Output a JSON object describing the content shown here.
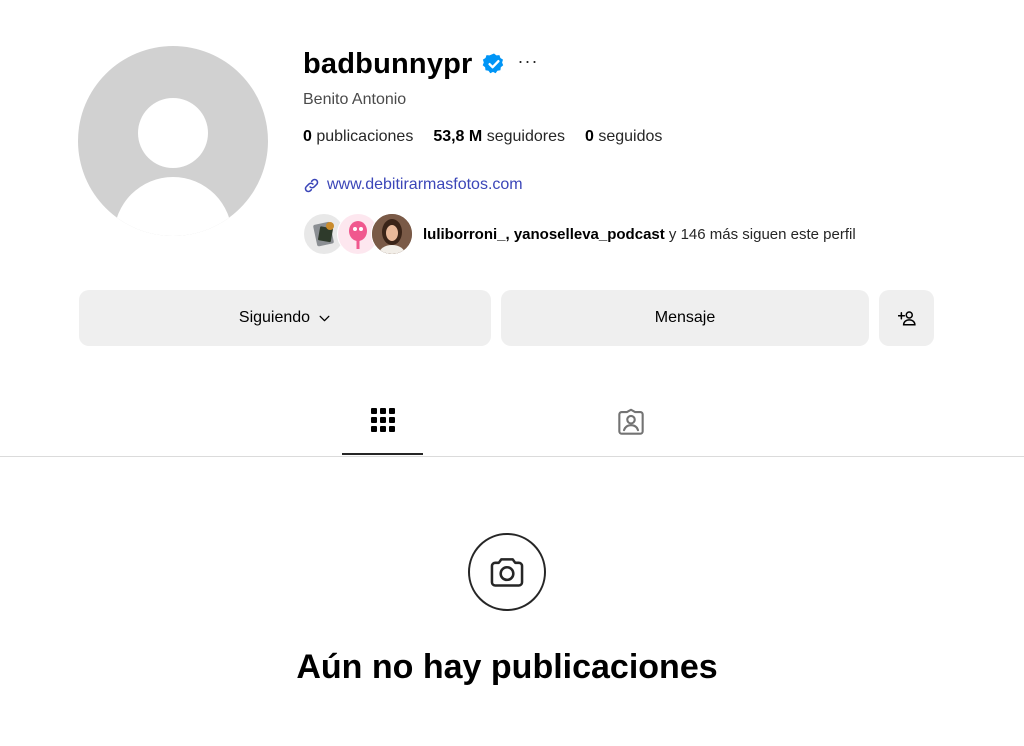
{
  "profile": {
    "username": "badbunnypr",
    "full_name": "Benito Antonio",
    "verified": true,
    "more_label": "···",
    "stats": {
      "posts_value": "0",
      "posts_label": "publicaciones",
      "followers_value": "53,8 M",
      "followers_label": "seguidores",
      "following_value": "0",
      "following_label": "seguidos"
    },
    "link_text": "www.debitirarmasfotos.com",
    "followed_by": {
      "names": "luliborroni_, yanoselleva_podcast",
      "suffix": " y 146 más siguen este perfil"
    }
  },
  "actions": {
    "following_label": "Siguiendo",
    "message_label": "Mensaje"
  },
  "tabs": [
    {
      "name": "posts",
      "icon": "grid-icon",
      "selected": true
    },
    {
      "name": "tagged",
      "icon": "tagged-icon",
      "selected": false
    }
  ],
  "empty_state": {
    "icon": "camera-icon",
    "title": "Aún no hay publicaciones"
  },
  "colors": {
    "verified_badge": "#0095f6",
    "link": "#3b46b8",
    "button_bg": "#efefef",
    "avatar_placeholder": "#d1d1d1"
  }
}
